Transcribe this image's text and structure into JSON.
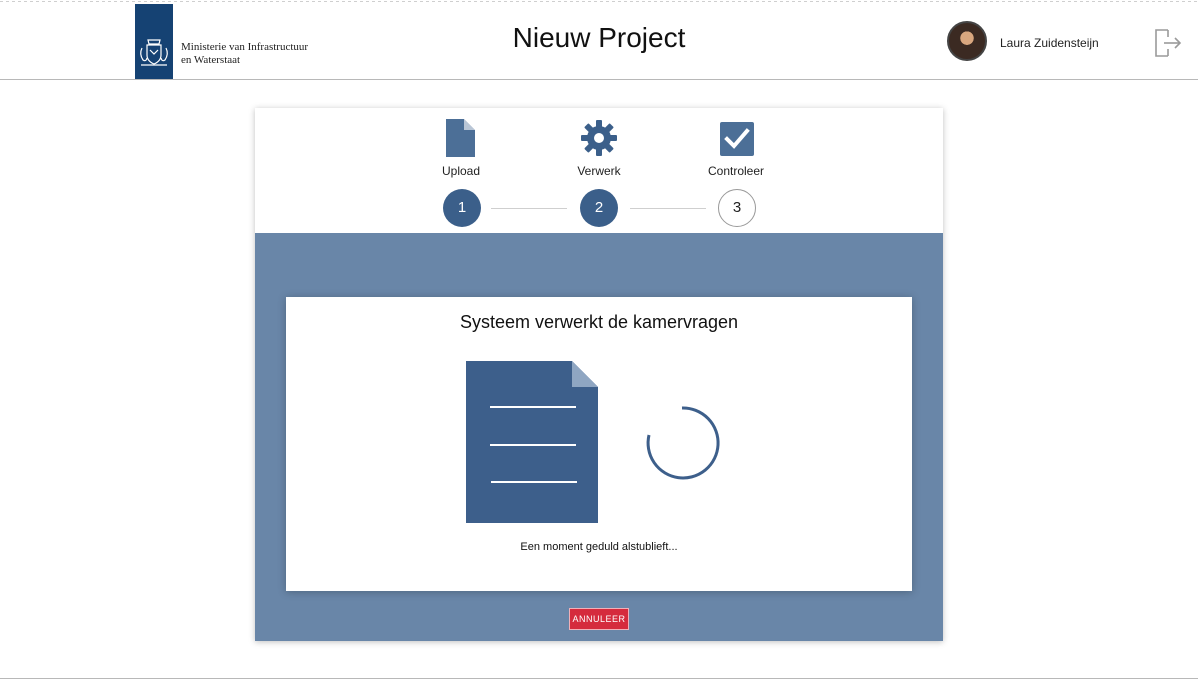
{
  "header": {
    "ministry_line1": "Ministerie van Infrastructuur",
    "ministry_line2": "en Waterstaat",
    "title": "Nieuw Project",
    "user_name": "Laura Zuidensteijn",
    "brand_color": "#154273",
    "icons": {
      "crest": "coat-of-arms-icon",
      "logout": "logout-icon"
    }
  },
  "steps": [
    {
      "label": "Upload",
      "number": "1",
      "icon": "document-icon",
      "state": "done"
    },
    {
      "label": "Verwerk",
      "number": "2",
      "icon": "gear-icon",
      "state": "active"
    },
    {
      "label": "Controleer",
      "number": "3",
      "icon": "checkbox-icon",
      "state": "todo"
    }
  ],
  "processing": {
    "title": "Systeem verwerkt de kamervragen",
    "message": "Een moment geduld alstublieft...",
    "cancel_label": "ANNULEER"
  },
  "colors": {
    "accent": "#3b5f8a",
    "work_area": "#6986a8",
    "cancel": "#d52b3d"
  }
}
